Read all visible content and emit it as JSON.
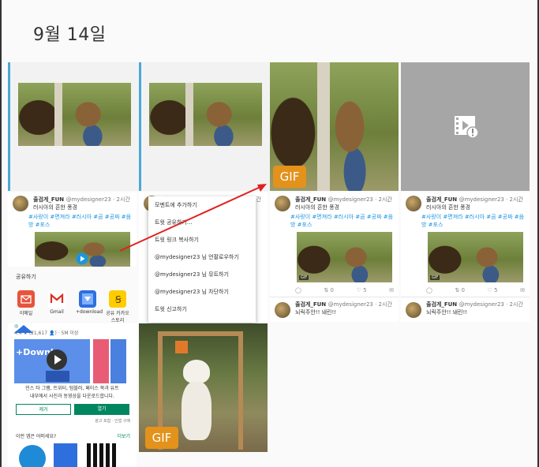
{
  "header": {
    "date": "9월 14일"
  },
  "gif_label": "GIF",
  "tweet": {
    "name": "출검게_FUN",
    "handle": "@mydesigner23 · 2시간",
    "text": "러시아의 흔한 풍경",
    "tags": "#사랑이 #면져라 #러시아 #곰 #공짜 #음방 #포스"
  },
  "tweet2": {
    "name": "출검게_FUN",
    "handle": "@mydesigner23 · 2시간",
    "text": "뇌릭주안!! 놰린!!"
  },
  "actions": {
    "reply": "",
    "retweet": "0",
    "like": "5",
    "mail": ""
  },
  "context_menu": [
    "모멘트에 추가하기",
    "트윗 공유하기...",
    "트윗 링크 복사하기",
    "@mydesigner23 님 언팔로우하기",
    "@mydesigner23 님 뮤트하기",
    "@mydesigner23 님 차단하기",
    "트윗 신고하기"
  ],
  "share_sheet": {
    "title": "공유하기",
    "apps": [
      {
        "label": "이메일",
        "color": "#e8533b"
      },
      {
        "label": "Gmail",
        "color": "#ffffff"
      },
      {
        "label": "+download",
        "color": "#2f6fdd"
      },
      {
        "label": "공유 카카오스토리",
        "color": "#ffcc00"
      }
    ]
  },
  "app_store": {
    "rating": "4.4 ★ (21,617 👤) · 5M 이상",
    "desc_line1": "인스 타 그램, 트위터, 텀블러, 페이스 북과 유트",
    "desc_line2": "내부에서 사진과 동영상을 다운로드합니다.",
    "btn_remove": "제거",
    "btn_open": "열기",
    "ads": "광고 포함 · 인앱 구매",
    "more_title": "이런 앱은 어떠세요?",
    "more_link": "더보기",
    "banner": "+Downl"
  }
}
